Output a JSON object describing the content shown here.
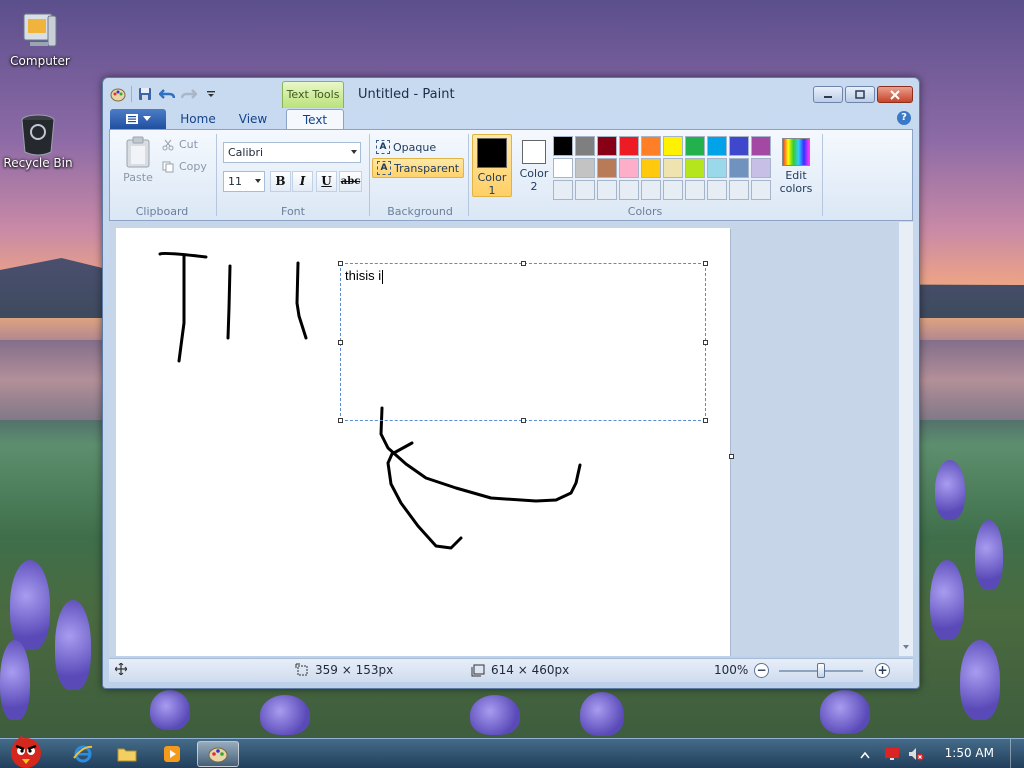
{
  "desktop": {
    "icons": [
      {
        "label": "Computer"
      },
      {
        "label": "Recycle Bin"
      }
    ]
  },
  "window": {
    "title": "Untitled - Paint",
    "context_tab": "Text Tools"
  },
  "ribbon": {
    "tabs": [
      "Home",
      "View",
      "Text"
    ],
    "active_tab": "Text",
    "clipboard": {
      "paste": "Paste",
      "cut": "Cut",
      "copy": "Copy",
      "label": "Clipboard"
    },
    "font": {
      "family": "Calibri",
      "size": "11",
      "label": "Font",
      "bold": "B",
      "italic": "I",
      "underline": "U",
      "strike": "abc"
    },
    "background": {
      "opaque": "Opaque",
      "transparent": "Transparent",
      "label": "Background"
    },
    "colors": {
      "color1": "Color\n1",
      "color1_line1": "Color",
      "color1_line2": "1",
      "color2_line1": "Color",
      "color2_line2": "2",
      "edit_line1": "Edit",
      "edit_line2": "colors",
      "label": "Colors",
      "color1_value": "#000000",
      "color2_value": "#ffffff",
      "palette_row1": [
        "#000000",
        "#7f7f7f",
        "#880015",
        "#ed1c24",
        "#ff7f27",
        "#fff200",
        "#22b14c",
        "#00a2e8",
        "#3f48cc",
        "#a349a4"
      ],
      "palette_row2": [
        "#ffffff",
        "#c3c3c3",
        "#b97a57",
        "#ffaec9",
        "#ffc90e",
        "#efe4b0",
        "#b5e61d",
        "#99d9ea",
        "#7092be",
        "#c8bfe7"
      ]
    }
  },
  "canvas": {
    "text_content": "thisis i"
  },
  "statusbar": {
    "selection_size": "359 × 153px",
    "image_size": "614 × 460px",
    "zoom": "100%"
  },
  "taskbar": {
    "clock": "1:50 AM"
  }
}
